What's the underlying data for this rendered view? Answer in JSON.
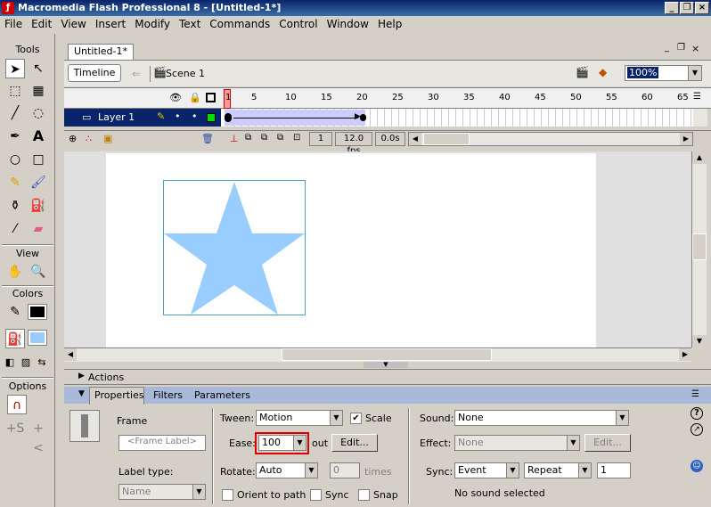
{
  "window": {
    "title": "Macromedia Flash Professional 8 - [Untitled-1*]",
    "app_icon": "flash-logo-icon"
  },
  "menu": [
    "File",
    "Edit",
    "View",
    "Insert",
    "Modify",
    "Text",
    "Commands",
    "Control",
    "Window",
    "Help"
  ],
  "tools": {
    "header": "Tools",
    "view_header": "View",
    "colors_header": "Colors",
    "options_header": "Options"
  },
  "document": {
    "tab": "Untitled-1*",
    "timeline_button": "Timeline",
    "scene": "Scene 1",
    "zoom": "100%"
  },
  "timeline": {
    "ruler": [
      "1",
      "5",
      "10",
      "15",
      "20",
      "25",
      "30",
      "35",
      "40",
      "45",
      "50",
      "55",
      "60",
      "65"
    ],
    "layer_name": "Layer 1",
    "current_frame": "1",
    "fps": "12.0 fps",
    "time": "0.0s"
  },
  "actions_label": "Actions",
  "properties": {
    "tabs": [
      "Properties",
      "Filters",
      "Parameters"
    ],
    "frame_label": "Frame",
    "frame_label_placeholder": "<Frame Label>",
    "label_type_label": "Label type:",
    "label_type_value": "Name",
    "tween_label": "Tween:",
    "tween_value": "Motion",
    "scale_label": "Scale",
    "ease_label": "Ease:",
    "ease_value": "100",
    "ease_out": "out",
    "edit_button": "Edit...",
    "rotate_label": "Rotate:",
    "rotate_value": "Auto",
    "times_value": "0",
    "times_label": "times",
    "orient_label": "Orient to path",
    "sync_label": "Sync",
    "snap_label": "Snap",
    "sound_label": "Sound:",
    "sound_value": "None",
    "effect_label": "Effect:",
    "effect_value": "None",
    "effect_edit": "Edit...",
    "sync_sound_label": "Sync:",
    "sync_event": "Event",
    "repeat_value": "Repeat",
    "repeat_count": "1",
    "no_sound": "No sound selected"
  },
  "colors": {
    "star_fill": "#99ccff",
    "highlight": "#dd0000",
    "title_bar": "#0a246a"
  }
}
